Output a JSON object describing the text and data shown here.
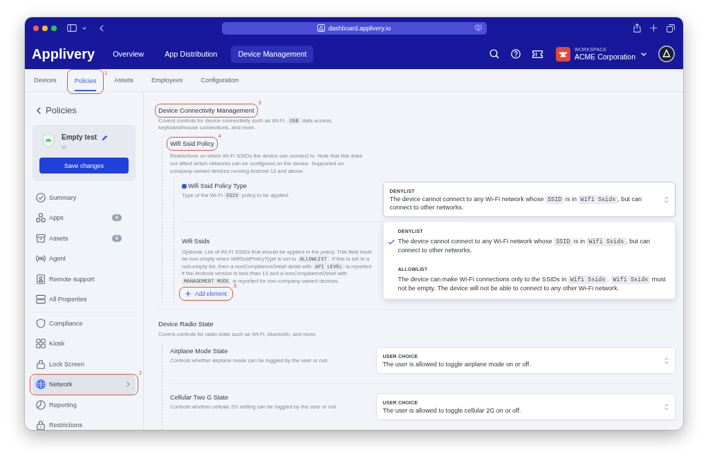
{
  "browser": {
    "url": "dashboard.applivery.io"
  },
  "app_header": {
    "logo": "Applivery",
    "nav": [
      {
        "label": "Overview",
        "selected": false
      },
      {
        "label": "App Distribution",
        "selected": false
      },
      {
        "label": "Device Management",
        "selected": true
      }
    ],
    "workspace": {
      "caption": "WORKSPACE",
      "name": "ACME Corporation"
    }
  },
  "tabs": [
    {
      "label": "Devices",
      "selected": false
    },
    {
      "label": "Policies",
      "selected": true,
      "callout": "1"
    },
    {
      "label": "Assets",
      "selected": false
    },
    {
      "label": "Employees",
      "selected": false
    },
    {
      "label": "Configuration",
      "selected": false
    }
  ],
  "sidebar": {
    "back": "Policies",
    "policy": {
      "name": "Empty test",
      "version": "v1",
      "save_button": "Save changes"
    },
    "nav_groups": [
      [
        {
          "label": "Summary",
          "selected": false
        },
        {
          "label": "Apps",
          "badge": "0",
          "selected": false
        },
        {
          "label": "Assets",
          "badge": "0",
          "selected": false
        },
        {
          "label": "Agent",
          "selected": false
        },
        {
          "label": "Remote support",
          "selected": false
        },
        {
          "label": "All Properties",
          "selected": false
        }
      ],
      [
        {
          "label": "Compliance",
          "selected": false
        },
        {
          "label": "Kiosk",
          "selected": false
        },
        {
          "label": "Lock Screen",
          "selected": false
        },
        {
          "label": "Network",
          "selected": true,
          "callout": "2"
        },
        {
          "label": "Reporting",
          "selected": false
        },
        {
          "label": "Restrictions",
          "selected": false
        }
      ]
    ]
  },
  "sections": [
    {
      "title": "Device Connectivity Management",
      "callout": "3",
      "description": [
        {
          "kind": "text",
          "text": "Covers controls for device connectivity such as Wi-Fi, "
        },
        {
          "kind": "code",
          "text": "USB"
        },
        {
          "kind": "text",
          "text": " data access, keyboard/mouse connections, and more."
        }
      ],
      "children": [
        {
          "kind": "group",
          "title": "Wifi Ssid Policy",
          "callout": "4",
          "description": [
            {
              "kind": "text",
              "text": "Restrictions on which Wi-Fi SSIDs the device can connect to. Note that this does not affect which networks can be configured on the device. Supported on company-owned devices running Android 13 and above."
            }
          ],
          "children": [
            {
              "kind": "select",
              "title": "Wifi Ssid Policy Type",
              "changed": true,
              "description": [
                {
                  "kind": "text",
                  "text": "Type of the Wi-Fi "
                },
                {
                  "kind": "code",
                  "text": "SSID"
                },
                {
                  "kind": "text",
                  "text": " policy to be applied."
                }
              ],
              "value": {
                "label": "DENYLIST",
                "description": [
                  {
                    "kind": "text",
                    "text": "The device cannot connect to any Wi-Fi network whose "
                  },
                  {
                    "kind": "code",
                    "text": "SSID"
                  },
                  {
                    "kind": "text",
                    "text": " is in "
                  },
                  {
                    "kind": "code",
                    "text": "Wifi Ssids"
                  },
                  {
                    "kind": "text",
                    "text": ", but can connect to other networks."
                  }
                ]
              },
              "expanded": true,
              "options": [
                {
                  "label": "DENYLIST",
                  "description": [
                    {
                      "kind": "text",
                      "text": "The device cannot connect to any Wi-Fi network whose "
                    },
                    {
                      "kind": "code",
                      "text": "SSID"
                    },
                    {
                      "kind": "text",
                      "text": " is in "
                    },
                    {
                      "kind": "code",
                      "text": "Wifi Ssids"
                    },
                    {
                      "kind": "text",
                      "text": ", but can connect to other networks."
                    }
                  ],
                  "selected": true
                },
                {
                  "label": "ALLOWLIST",
                  "description": [
                    {
                      "kind": "text",
                      "text": "The device can make Wi-Fi connections only to the SSIDs in "
                    },
                    {
                      "kind": "code",
                      "text": "Wifi Ssids"
                    },
                    {
                      "kind": "text",
                      "text": ". "
                    },
                    {
                      "kind": "code",
                      "text": "Wifi Ssids"
                    },
                    {
                      "kind": "text",
                      "text": " must not be empty. The device will not be able to connect to any other Wi-Fi network."
                    }
                  ],
                  "selected": false
                }
              ]
            },
            {
              "kind": "list",
              "title": "Wifi Ssids",
              "changed": false,
              "description": [
                {
                  "kind": "text",
                  "text": "Optional. List of Wi-Fi SSIDs that should be applied in the policy. This field must be non-empty when *WifiSsidPolicyType* is set to "
                },
                {
                  "kind": "code",
                  "text": "ALLOWLIST"
                },
                {
                  "kind": "text",
                  "text": ". If this is set to a non-empty list, then a *nonComplianceDetail* detail with "
                },
                {
                  "kind": "code",
                  "text": "API LEVEL"
                },
                {
                  "kind": "text",
                  "text": " is reported if the Android version is less than 13 and a *nonComplianceDetail* with "
                },
                {
                  "kind": "code",
                  "text": "MANAGEMENT MODE"
                },
                {
                  "kind": "text",
                  "text": " is reported for non-company-owned devices."
                }
              ],
              "add_button": {
                "label": "Add element",
                "callout": "5"
              }
            }
          ]
        }
      ]
    },
    {
      "title": "Device Radio State",
      "description": [
        {
          "kind": "text",
          "text": "Covers controls for radio state such as Wi-Fi, bluetooth, and more."
        }
      ],
      "children": [
        {
          "kind": "select",
          "title": "Airplane Mode State",
          "changed": false,
          "description": [
            {
              "kind": "text",
              "text": "Controls whether airplane mode can be toggled by the user or not."
            }
          ],
          "value": {
            "label": "USER CHOICE",
            "description": [
              {
                "kind": "text",
                "text": "The user is allowed to toggle airplane mode on or off."
              }
            ]
          }
        },
        {
          "kind": "select",
          "title": "Cellular Two G State",
          "changed": false,
          "description": [
            {
              "kind": "text",
              "text": "Controls whether cellular 2G setting can be toggled by the user or not."
            }
          ],
          "value": {
            "label": "USER CHOICE",
            "description": [
              {
                "kind": "text",
                "text": "The user is allowed to toggle cellular 2G on or off."
              }
            ]
          }
        }
      ]
    }
  ]
}
